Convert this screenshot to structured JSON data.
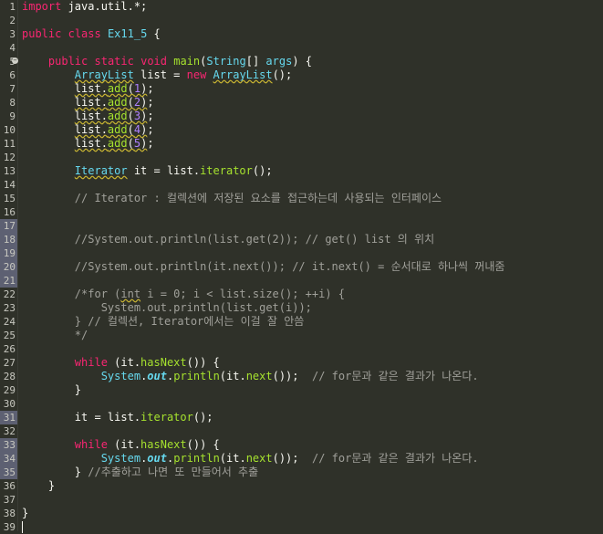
{
  "editor": {
    "lines": [
      {
        "n": "1",
        "segs": [
          {
            "t": "import",
            "c": "kw"
          },
          {
            "t": " java.util.*;",
            "c": "plain"
          }
        ]
      },
      {
        "n": "2",
        "segs": []
      },
      {
        "n": "3",
        "segs": [
          {
            "t": "public",
            "c": "kw"
          },
          {
            "t": " ",
            "c": "plain"
          },
          {
            "t": "class",
            "c": "kw"
          },
          {
            "t": " ",
            "c": "plain"
          },
          {
            "t": "Ex11_5",
            "c": "ty"
          },
          {
            "t": " {",
            "c": "plain"
          }
        ]
      },
      {
        "n": "4",
        "segs": []
      },
      {
        "n": "5",
        "fold": true,
        "segs": [
          {
            "t": "    ",
            "c": "plain"
          },
          {
            "t": "public",
            "c": "kw"
          },
          {
            "t": " ",
            "c": "plain"
          },
          {
            "t": "static",
            "c": "kw"
          },
          {
            "t": " ",
            "c": "plain"
          },
          {
            "t": "void",
            "c": "kw"
          },
          {
            "t": " ",
            "c": "plain"
          },
          {
            "t": "main",
            "c": "fn"
          },
          {
            "t": "(",
            "c": "plain"
          },
          {
            "t": "String",
            "c": "ty"
          },
          {
            "t": "[] ",
            "c": "plain"
          },
          {
            "t": "args",
            "c": "ty"
          },
          {
            "t": ") {",
            "c": "plain"
          }
        ]
      },
      {
        "n": "6",
        "segs": [
          {
            "t": "        ",
            "c": "plain"
          },
          {
            "t": "ArrayList",
            "c": "ty",
            "u": true
          },
          {
            "t": " list = ",
            "c": "plain"
          },
          {
            "t": "new",
            "c": "kw"
          },
          {
            "t": " ",
            "c": "plain"
          },
          {
            "t": "ArrayList",
            "c": "ty",
            "u": true
          },
          {
            "t": "();",
            "c": "plain"
          }
        ]
      },
      {
        "n": "7",
        "segs": [
          {
            "t": "        ",
            "c": "plain"
          },
          {
            "t": "list.",
            "c": "plain",
            "u": true
          },
          {
            "t": "add",
            "c": "fn",
            "u": true
          },
          {
            "t": "(",
            "c": "plain",
            "u": true
          },
          {
            "t": "1",
            "c": "nm",
            "u": true
          },
          {
            "t": ")",
            "c": "plain",
            "u": true
          },
          {
            "t": ";",
            "c": "plain"
          }
        ]
      },
      {
        "n": "8",
        "segs": [
          {
            "t": "        ",
            "c": "plain"
          },
          {
            "t": "list.",
            "c": "plain",
            "u": true
          },
          {
            "t": "add",
            "c": "fn",
            "u": true
          },
          {
            "t": "(",
            "c": "plain",
            "u": true
          },
          {
            "t": "2",
            "c": "nm",
            "u": true
          },
          {
            "t": ")",
            "c": "plain",
            "u": true
          },
          {
            "t": ";",
            "c": "plain"
          }
        ]
      },
      {
        "n": "9",
        "segs": [
          {
            "t": "        ",
            "c": "plain"
          },
          {
            "t": "list.",
            "c": "plain",
            "u": true
          },
          {
            "t": "add",
            "c": "fn",
            "u": true
          },
          {
            "t": "(",
            "c": "plain",
            "u": true
          },
          {
            "t": "3",
            "c": "nm",
            "u": true
          },
          {
            "t": ")",
            "c": "plain",
            "u": true
          },
          {
            "t": ";",
            "c": "plain"
          }
        ]
      },
      {
        "n": "10",
        "segs": [
          {
            "t": "        ",
            "c": "plain"
          },
          {
            "t": "list.",
            "c": "plain",
            "u": true
          },
          {
            "t": "add",
            "c": "fn",
            "u": true
          },
          {
            "t": "(",
            "c": "plain",
            "u": true
          },
          {
            "t": "4",
            "c": "nm",
            "u": true
          },
          {
            "t": ")",
            "c": "plain",
            "u": true
          },
          {
            "t": ";",
            "c": "plain"
          }
        ]
      },
      {
        "n": "11",
        "segs": [
          {
            "t": "        ",
            "c": "plain"
          },
          {
            "t": "list.",
            "c": "plain",
            "u": true
          },
          {
            "t": "add",
            "c": "fn",
            "u": true
          },
          {
            "t": "(",
            "c": "plain",
            "u": true
          },
          {
            "t": "5",
            "c": "nm",
            "u": true
          },
          {
            "t": ")",
            "c": "plain",
            "u": true
          },
          {
            "t": ";",
            "c": "plain"
          }
        ]
      },
      {
        "n": "12",
        "segs": []
      },
      {
        "n": "13",
        "segs": [
          {
            "t": "        ",
            "c": "plain"
          },
          {
            "t": "Iterator",
            "c": "ty",
            "u": true
          },
          {
            "t": " it = list.",
            "c": "plain"
          },
          {
            "t": "iterator",
            "c": "fn"
          },
          {
            "t": "();",
            "c": "plain"
          }
        ]
      },
      {
        "n": "14",
        "segs": []
      },
      {
        "n": "15",
        "segs": [
          {
            "t": "        ",
            "c": "plain"
          },
          {
            "t": "// Iterator : 컬렉션에 저장된 요소를 접근하는데 사용되는 인터페이스",
            "c": "cm"
          }
        ]
      },
      {
        "n": "16",
        "segs": []
      },
      {
        "n": "17",
        "mark": true,
        "segs": []
      },
      {
        "n": "18",
        "mark": true,
        "segs": [
          {
            "t": "        ",
            "c": "plain"
          },
          {
            "t": "//System.out.println(list.get(2)); // get() list 의 위치",
            "c": "cm"
          }
        ]
      },
      {
        "n": "19",
        "mark": true,
        "segs": []
      },
      {
        "n": "20",
        "mark": true,
        "segs": [
          {
            "t": "        ",
            "c": "plain"
          },
          {
            "t": "//System.out.println(it.next()); // it.next() = 순서대로 하나씩 꺼내줌",
            "c": "cm"
          }
        ]
      },
      {
        "n": "21",
        "mark": true,
        "segs": []
      },
      {
        "n": "22",
        "segs": [
          {
            "t": "        ",
            "c": "plain"
          },
          {
            "t": "/*for (",
            "c": "cm"
          },
          {
            "t": "int",
            "c": "cm",
            "u": true
          },
          {
            "t": " i = 0; i < list.size(); ++i) {",
            "c": "cm"
          }
        ]
      },
      {
        "n": "23",
        "segs": [
          {
            "t": "            ",
            "c": "plain"
          },
          {
            "t": "System.out.println(list.get(i));",
            "c": "cm"
          }
        ]
      },
      {
        "n": "24",
        "segs": [
          {
            "t": "        ",
            "c": "plain"
          },
          {
            "t": "} // 컬렉션, Iterator에서는 이걸 잘 안씀",
            "c": "cm"
          }
        ]
      },
      {
        "n": "25",
        "segs": [
          {
            "t": "        ",
            "c": "plain"
          },
          {
            "t": "*/",
            "c": "cm"
          }
        ]
      },
      {
        "n": "26",
        "segs": []
      },
      {
        "n": "27",
        "segs": [
          {
            "t": "        ",
            "c": "plain"
          },
          {
            "t": "while",
            "c": "kw"
          },
          {
            "t": " (it.",
            "c": "plain"
          },
          {
            "t": "hasNext",
            "c": "fn"
          },
          {
            "t": "()) {",
            "c": "plain"
          }
        ]
      },
      {
        "n": "28",
        "segs": [
          {
            "t": "            ",
            "c": "plain"
          },
          {
            "t": "System",
            "c": "ty"
          },
          {
            "t": ".",
            "c": "plain"
          },
          {
            "t": "out",
            "c": "st"
          },
          {
            "t": ".",
            "c": "plain"
          },
          {
            "t": "println",
            "c": "fn"
          },
          {
            "t": "(it.",
            "c": "plain"
          },
          {
            "t": "next",
            "c": "fn"
          },
          {
            "t": "());  ",
            "c": "plain"
          },
          {
            "t": "// for문과 같은 결과가 나온다.",
            "c": "cm"
          }
        ]
      },
      {
        "n": "29",
        "segs": [
          {
            "t": "        }",
            "c": "plain"
          }
        ]
      },
      {
        "n": "30",
        "segs": []
      },
      {
        "n": "31",
        "mark": true,
        "segs": [
          {
            "t": "        it = list.",
            "c": "plain"
          },
          {
            "t": "iterator",
            "c": "fn"
          },
          {
            "t": "();",
            "c": "plain"
          }
        ]
      },
      {
        "n": "32",
        "segs": []
      },
      {
        "n": "33",
        "mark": true,
        "segs": [
          {
            "t": "        ",
            "c": "plain"
          },
          {
            "t": "while",
            "c": "kw"
          },
          {
            "t": " (it.",
            "c": "plain"
          },
          {
            "t": "hasNext",
            "c": "fn"
          },
          {
            "t": "()) {",
            "c": "plain"
          }
        ]
      },
      {
        "n": "34",
        "mark": true,
        "segs": [
          {
            "t": "            ",
            "c": "plain"
          },
          {
            "t": "System",
            "c": "ty"
          },
          {
            "t": ".",
            "c": "plain"
          },
          {
            "t": "out",
            "c": "st"
          },
          {
            "t": ".",
            "c": "plain"
          },
          {
            "t": "println",
            "c": "fn"
          },
          {
            "t": "(it.",
            "c": "plain"
          },
          {
            "t": "next",
            "c": "fn"
          },
          {
            "t": "());  ",
            "c": "plain"
          },
          {
            "t": "// for문과 같은 결과가 나온다.",
            "c": "cm"
          }
        ]
      },
      {
        "n": "35",
        "mark": true,
        "segs": [
          {
            "t": "        } ",
            "c": "plain"
          },
          {
            "t": "//추출하고 나면 또 만들어서 추출",
            "c": "cm"
          }
        ]
      },
      {
        "n": "36",
        "segs": [
          {
            "t": "    }",
            "c": "plain"
          }
        ]
      },
      {
        "n": "37",
        "segs": []
      },
      {
        "n": "38",
        "segs": [
          {
            "t": "}",
            "c": "plain"
          }
        ]
      },
      {
        "n": "39",
        "cursor": true,
        "segs": []
      }
    ]
  }
}
